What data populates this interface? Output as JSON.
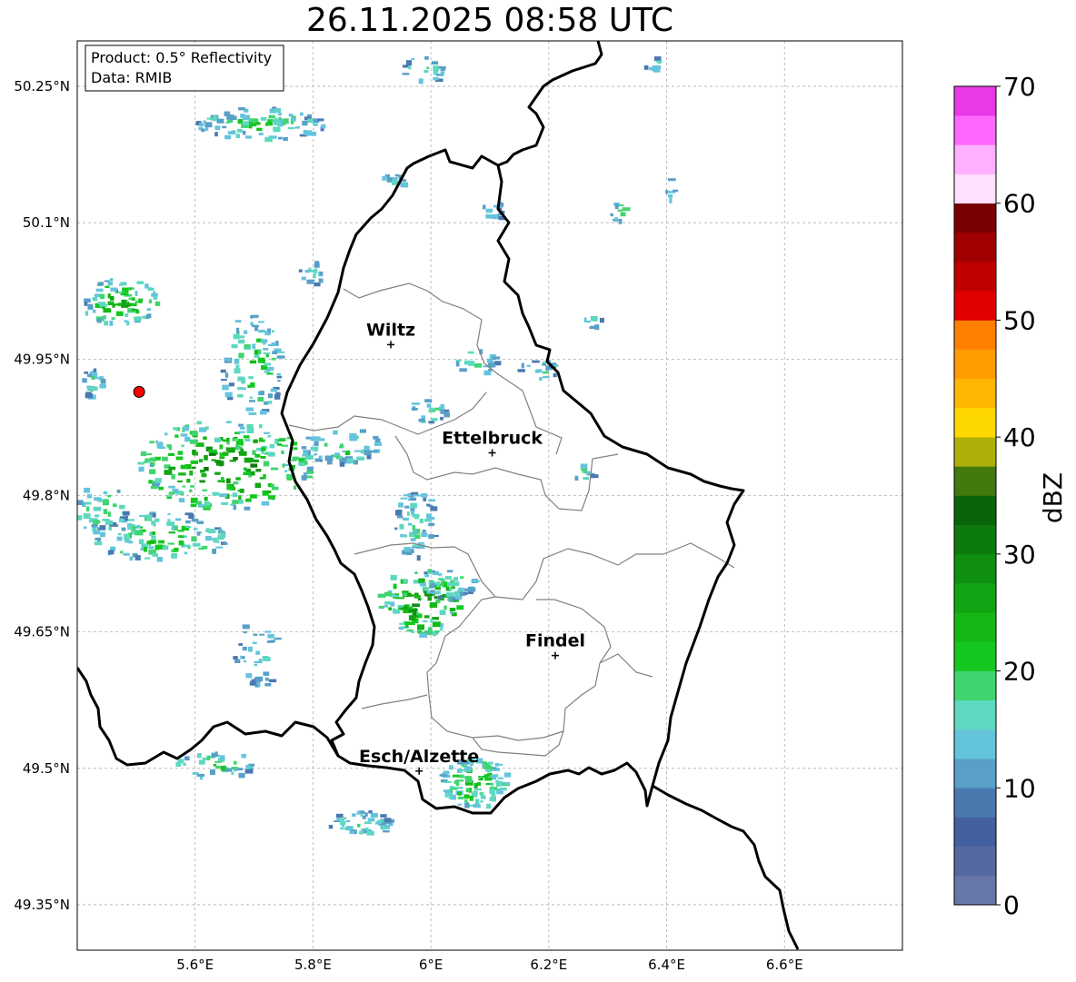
{
  "title": "26.11.2025 08:58 UTC",
  "info_box": {
    "product": "Product: 0.5° Reflectivity",
    "data": "Data: RMIB"
  },
  "map": {
    "lon_range": [
      5.4,
      6.8
    ],
    "lat_range": [
      49.3,
      50.3
    ],
    "lon_ticks": [
      {
        "value": 5.6,
        "label": "5.6°E"
      },
      {
        "value": 5.8,
        "label": "5.8°E"
      },
      {
        "value": 6.0,
        "label": "6°E"
      },
      {
        "value": 6.2,
        "label": "6.2°E"
      },
      {
        "value": 6.4,
        "label": "6.4°E"
      },
      {
        "value": 6.6,
        "label": "6.6°E"
      }
    ],
    "lat_ticks": [
      {
        "value": 50.25,
        "label": "50.25°N"
      },
      {
        "value": 50.1,
        "label": "50.1°N"
      },
      {
        "value": 49.95,
        "label": "49.95°N"
      },
      {
        "value": 49.8,
        "label": "49.8°N"
      },
      {
        "value": 49.65,
        "label": "49.65°N"
      },
      {
        "value": 49.5,
        "label": "49.5°N"
      },
      {
        "value": 49.35,
        "label": "49.35°N"
      }
    ],
    "grid": true,
    "radar_site": {
      "lon": 5.505,
      "lat": 49.914,
      "color": "#ff0000"
    },
    "cities": [
      {
        "name": "Wiltz",
        "lon": 5.932,
        "lat": 49.966
      },
      {
        "name": "Ettelbruck",
        "lon": 6.104,
        "lat": 49.847
      },
      {
        "name": "Findel",
        "lon": 6.211,
        "lat": 49.624
      },
      {
        "name": "Esch/Alzette",
        "lon": 5.98,
        "lat": 49.497
      }
    ]
  },
  "colorbar": {
    "label": "dBZ",
    "min": 0,
    "max": 70,
    "ticks": [
      {
        "value": 0,
        "label": "0"
      },
      {
        "value": 10,
        "label": "10"
      },
      {
        "value": 20,
        "label": "20"
      },
      {
        "value": 30,
        "label": "30"
      },
      {
        "value": 40,
        "label": "40"
      },
      {
        "value": 50,
        "label": "50"
      },
      {
        "value": 60,
        "label": "60"
      },
      {
        "value": 70,
        "label": "70"
      }
    ],
    "colors": [
      "#6677a8",
      "#5469a0",
      "#44609e",
      "#4a79b0",
      "#58a0c8",
      "#64c4dc",
      "#5ed8c0",
      "#40d470",
      "#14c820",
      "#14b814",
      "#12a414",
      "#0f900f",
      "#0c7a0c",
      "#0a640a",
      "#437a10",
      "#adb00a",
      "#ffd700",
      "#ffb600",
      "#ff9c00",
      "#ff8000",
      "#e00000",
      "#c00000",
      "#a00000",
      "#780000",
      "#ffe0ff",
      "#ffb0ff",
      "#ff68ff",
      "#e838e8"
    ]
  }
}
